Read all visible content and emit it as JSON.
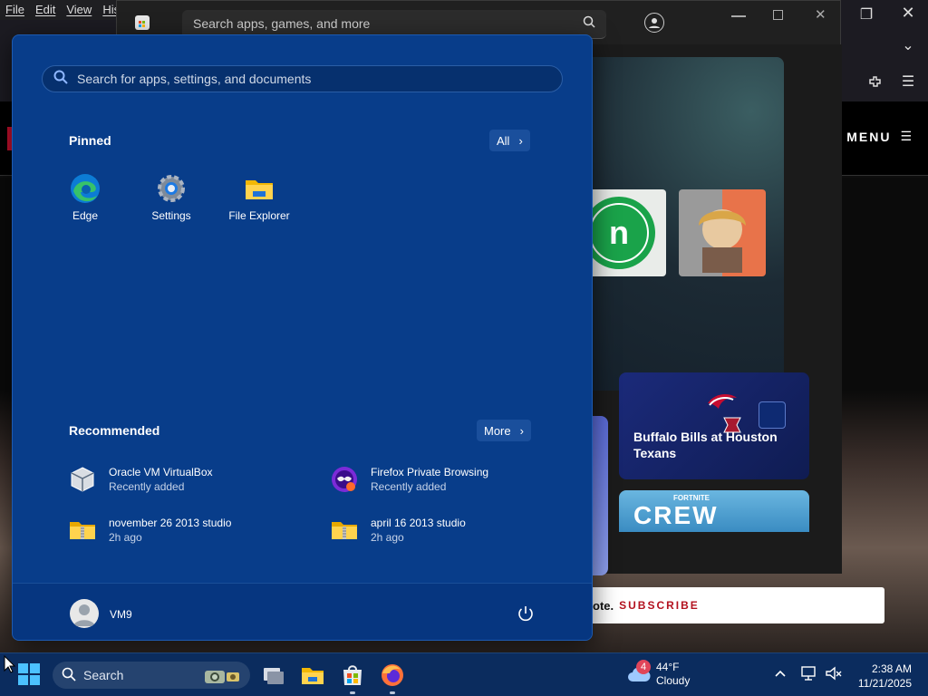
{
  "browser": {
    "menubar": [
      "File",
      "Edit",
      "View",
      "Histo"
    ],
    "site_menu_label": "MENU",
    "subscribe_text": "ote.",
    "subscribe_link": "SUBSCRIBE"
  },
  "store": {
    "search_placeholder": "Search apps, games, and more",
    "cards": [
      {
        "title": "Buffalo Bills at Houston Texans"
      },
      {
        "title": "CREW",
        "brand": "FORTNITE"
      }
    ]
  },
  "start_menu": {
    "search_placeholder": "Search for apps, settings, and documents",
    "pinned_title": "Pinned",
    "all_button": "All",
    "pinned": [
      {
        "label": "Edge",
        "icon": "edge-icon"
      },
      {
        "label": "Settings",
        "icon": "settings-gear-icon"
      },
      {
        "label": "File Explorer",
        "icon": "folder-icon"
      }
    ],
    "recommended_title": "Recommended",
    "more_button": "More",
    "recommended": [
      {
        "name": "Oracle VM VirtualBox",
        "sub": "Recently added",
        "icon": "virtualbox-icon"
      },
      {
        "name": "Firefox Private Browsing",
        "sub": "Recently added",
        "icon": "firefox-private-icon"
      },
      {
        "name": "november 26 2013 studio",
        "sub": "2h ago",
        "icon": "zip-folder-icon"
      },
      {
        "name": "april 16 2013 studio",
        "sub": "2h ago",
        "icon": "zip-folder-icon"
      }
    ],
    "user_name": "VM9"
  },
  "taskbar": {
    "search_label": "Search",
    "weather_badge": "4",
    "temperature": "44°F",
    "condition": "Cloudy",
    "time": "2:38 AM",
    "date": "11/21/2025"
  },
  "colors": {
    "start_bg": "#083d8a",
    "taskbar_bg": "#0b2c5e",
    "subscribe_red": "#b3121f"
  }
}
